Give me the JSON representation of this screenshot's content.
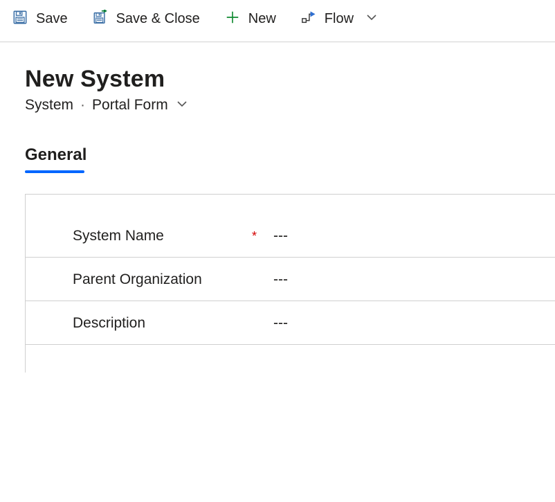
{
  "commands": {
    "save": "Save",
    "save_close": "Save & Close",
    "new": "New",
    "flow": "Flow"
  },
  "header": {
    "title": "New System",
    "entity": "System",
    "form_name": "Portal Form"
  },
  "tabs": [
    {
      "label": "General"
    }
  ],
  "fields": [
    {
      "label": "System Name",
      "required": true,
      "value": "---"
    },
    {
      "label": "Parent Organization",
      "required": false,
      "value": "---"
    },
    {
      "label": "Description",
      "required": false,
      "value": "---"
    }
  ],
  "glyphs": {
    "required_marker": "*",
    "empty_value": "---"
  }
}
